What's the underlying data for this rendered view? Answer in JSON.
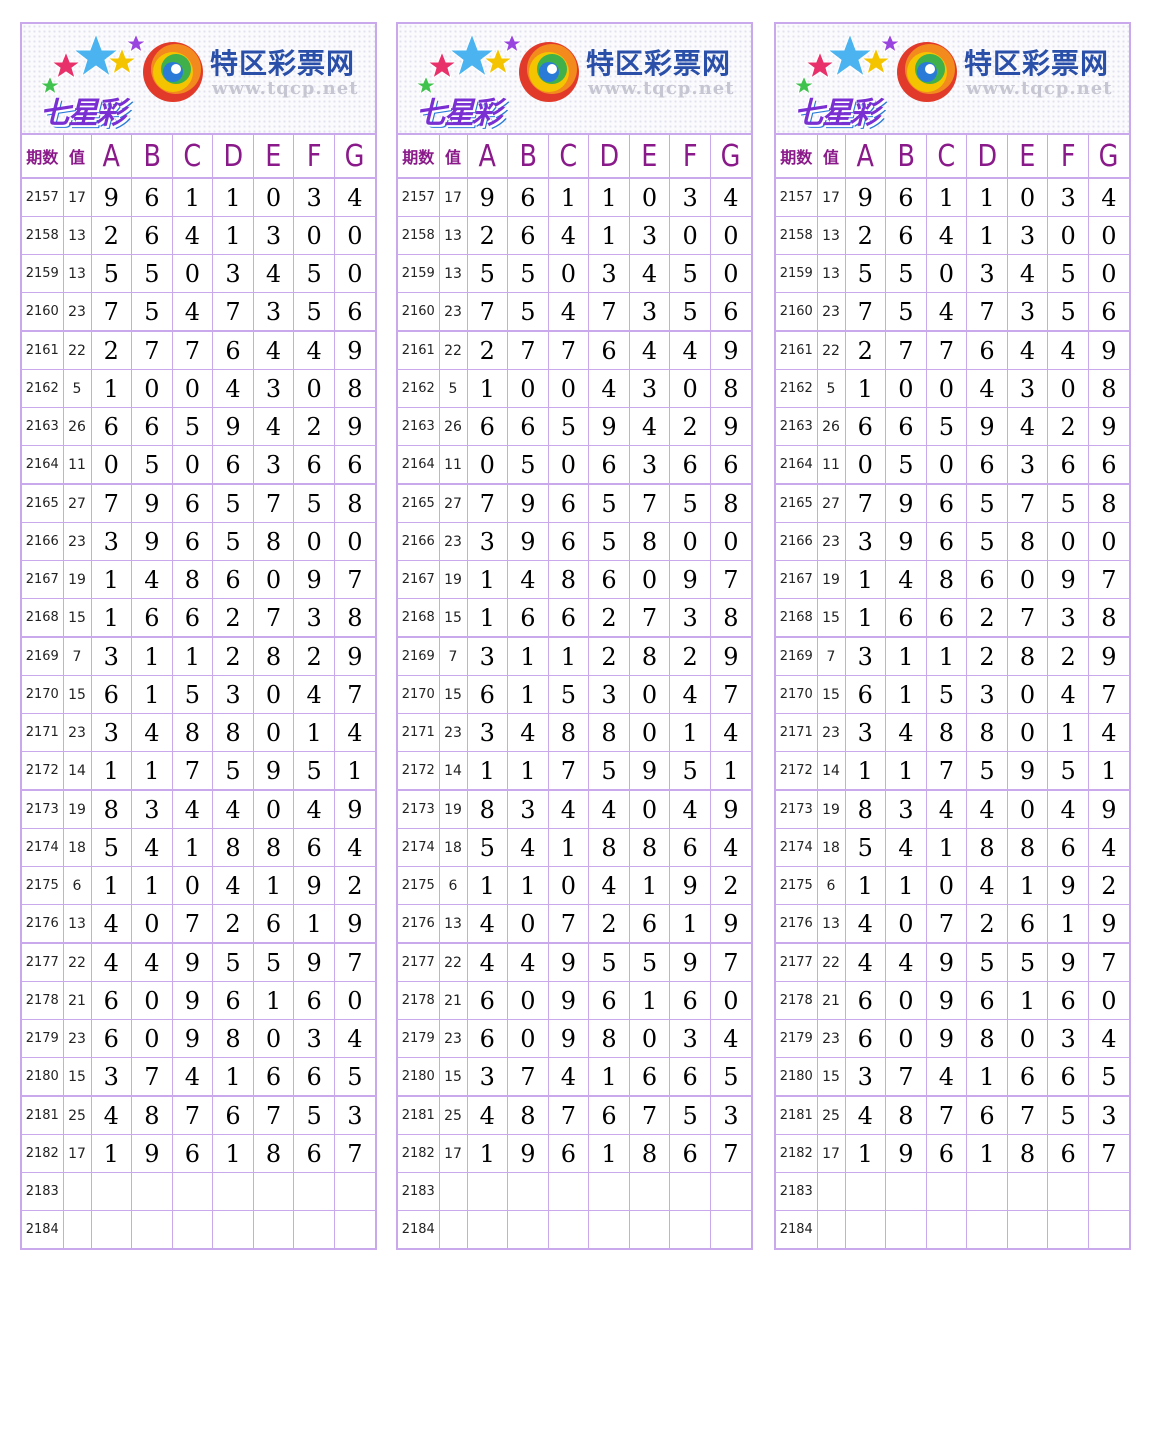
{
  "banner": {
    "lottery_name": "七星彩",
    "brand": "特区彩票网",
    "site": "www.tqcp.net"
  },
  "headers": {
    "issue": "期数",
    "value": "值",
    "columns": [
      "A",
      "B",
      "C",
      "D",
      "E",
      "F",
      "G"
    ]
  },
  "rows": [
    {
      "issue": "2157",
      "value": "17",
      "digits": [
        "9",
        "6",
        "1",
        "1",
        "0",
        "3",
        "4"
      ]
    },
    {
      "issue": "2158",
      "value": "13",
      "digits": [
        "2",
        "6",
        "4",
        "1",
        "3",
        "0",
        "0"
      ]
    },
    {
      "issue": "2159",
      "value": "13",
      "digits": [
        "5",
        "5",
        "0",
        "3",
        "4",
        "5",
        "0"
      ]
    },
    {
      "issue": "2160",
      "value": "23",
      "digits": [
        "7",
        "5",
        "4",
        "7",
        "3",
        "5",
        "6"
      ]
    },
    {
      "issue": "2161",
      "value": "22",
      "digits": [
        "2",
        "7",
        "7",
        "6",
        "4",
        "4",
        "9"
      ]
    },
    {
      "issue": "2162",
      "value": "5",
      "digits": [
        "1",
        "0",
        "0",
        "4",
        "3",
        "0",
        "8"
      ]
    },
    {
      "issue": "2163",
      "value": "26",
      "digits": [
        "6",
        "6",
        "5",
        "9",
        "4",
        "2",
        "9"
      ]
    },
    {
      "issue": "2164",
      "value": "11",
      "digits": [
        "0",
        "5",
        "0",
        "6",
        "3",
        "6",
        "6"
      ]
    },
    {
      "issue": "2165",
      "value": "27",
      "digits": [
        "7",
        "9",
        "6",
        "5",
        "7",
        "5",
        "8"
      ]
    },
    {
      "issue": "2166",
      "value": "23",
      "digits": [
        "3",
        "9",
        "6",
        "5",
        "8",
        "0",
        "0"
      ]
    },
    {
      "issue": "2167",
      "value": "19",
      "digits": [
        "1",
        "4",
        "8",
        "6",
        "0",
        "9",
        "7"
      ]
    },
    {
      "issue": "2168",
      "value": "15",
      "digits": [
        "1",
        "6",
        "6",
        "2",
        "7",
        "3",
        "8"
      ]
    },
    {
      "issue": "2169",
      "value": "7",
      "digits": [
        "3",
        "1",
        "1",
        "2",
        "8",
        "2",
        "9"
      ]
    },
    {
      "issue": "2170",
      "value": "15",
      "digits": [
        "6",
        "1",
        "5",
        "3",
        "0",
        "4",
        "7"
      ]
    },
    {
      "issue": "2171",
      "value": "23",
      "digits": [
        "3",
        "4",
        "8",
        "8",
        "0",
        "1",
        "4"
      ]
    },
    {
      "issue": "2172",
      "value": "14",
      "digits": [
        "1",
        "1",
        "7",
        "5",
        "9",
        "5",
        "1"
      ]
    },
    {
      "issue": "2173",
      "value": "19",
      "digits": [
        "8",
        "3",
        "4",
        "4",
        "0",
        "4",
        "9"
      ]
    },
    {
      "issue": "2174",
      "value": "18",
      "digits": [
        "5",
        "4",
        "1",
        "8",
        "8",
        "6",
        "4"
      ]
    },
    {
      "issue": "2175",
      "value": "6",
      "digits": [
        "1",
        "1",
        "0",
        "4",
        "1",
        "9",
        "2"
      ]
    },
    {
      "issue": "2176",
      "value": "13",
      "digits": [
        "4",
        "0",
        "7",
        "2",
        "6",
        "1",
        "9"
      ]
    },
    {
      "issue": "2177",
      "value": "22",
      "digits": [
        "4",
        "4",
        "9",
        "5",
        "5",
        "9",
        "7"
      ]
    },
    {
      "issue": "2178",
      "value": "21",
      "digits": [
        "6",
        "0",
        "9",
        "6",
        "1",
        "6",
        "0"
      ]
    },
    {
      "issue": "2179",
      "value": "23",
      "digits": [
        "6",
        "0",
        "9",
        "8",
        "0",
        "3",
        "4"
      ]
    },
    {
      "issue": "2180",
      "value": "15",
      "digits": [
        "3",
        "7",
        "4",
        "1",
        "6",
        "6",
        "5"
      ]
    },
    {
      "issue": "2181",
      "value": "25",
      "digits": [
        "4",
        "8",
        "7",
        "6",
        "7",
        "5",
        "3"
      ]
    },
    {
      "issue": "2182",
      "value": "17",
      "digits": [
        "1",
        "9",
        "6",
        "1",
        "8",
        "6",
        "7"
      ]
    },
    {
      "issue": "2183",
      "value": "",
      "digits": [
        "",
        "",
        "",
        "",
        "",
        "",
        ""
      ]
    },
    {
      "issue": "2184",
      "value": "",
      "digits": [
        "",
        "",
        "",
        "",
        "",
        "",
        ""
      ]
    }
  ]
}
